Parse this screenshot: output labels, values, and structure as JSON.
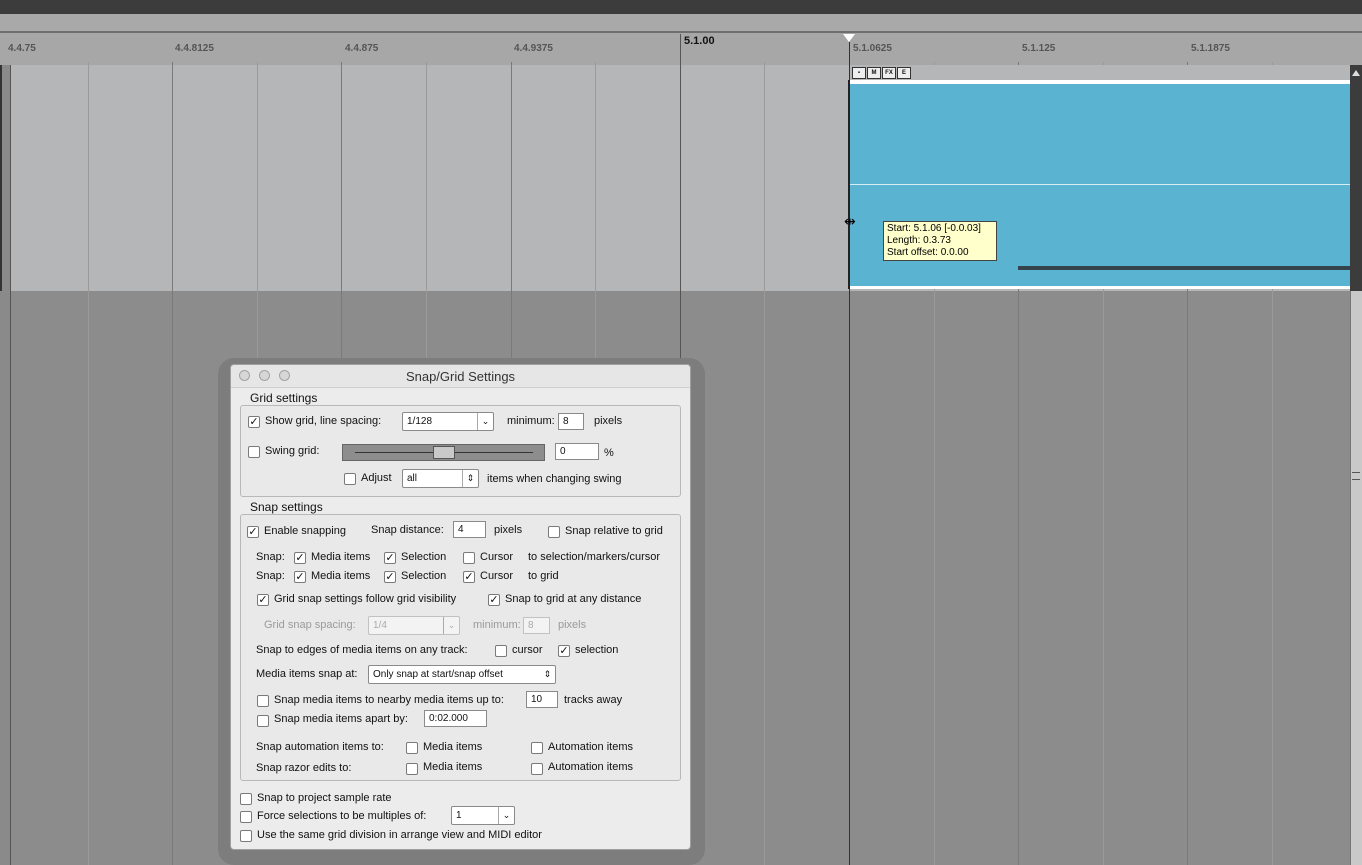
{
  "ruler": {
    "labels": [
      "4.4.75",
      "4.4.8125",
      "4.4.875",
      "4.4.9375",
      "5.1.00",
      "5.1.0625",
      "5.1.125",
      "5.1.1875"
    ]
  },
  "item_buttons": [
    "lock",
    "M",
    "FX",
    "E"
  ],
  "tooltip": {
    "start": "Start: 5.1.06 [-0.0.03]",
    "length": "Length: 0.3.73",
    "offset": "Start offset: 0.0.00"
  },
  "dialog": {
    "title": "Snap/Grid Settings",
    "grid": {
      "heading": "Grid settings",
      "show_grid_label": "Show grid, line spacing:",
      "show_grid_checked": true,
      "line_spacing": "1/128",
      "minimum_label": "minimum:",
      "minimum_value": "8",
      "pixels": "pixels",
      "swing_label": "Swing grid:",
      "swing_checked": false,
      "swing_value": "0",
      "percent": "%",
      "swing_level": 0.5,
      "adjust_label": "Adjust",
      "adjust_checked": false,
      "adjust_value": "all",
      "adjust_suffix": "items when changing swing"
    },
    "snap": {
      "heading": "Snap settings",
      "enable_label": "Enable snapping",
      "enable_checked": true,
      "distance_label": "Snap distance:",
      "distance_value": "4",
      "pixels": "pixels",
      "relative_label": "Snap relative to grid",
      "relative_checked": false,
      "row1": {
        "prefix": "Snap:",
        "media": "Media items",
        "media_checked": true,
        "selection": "Selection",
        "selection_checked": true,
        "cursor": "Cursor",
        "cursor_checked": false,
        "suffix": "to selection/markers/cursor"
      },
      "row2": {
        "prefix": "Snap:",
        "media": "Media items",
        "media_checked": true,
        "selection": "Selection",
        "selection_checked": true,
        "cursor": "Cursor",
        "cursor_checked": true,
        "suffix": "to grid"
      },
      "follow_label": "Grid snap settings follow grid visibility",
      "follow_checked": true,
      "any_distance_label": "Snap to grid at any distance",
      "any_distance_checked": true,
      "grid_spacing_label": "Grid snap spacing:",
      "grid_spacing_value": "1/4",
      "grid_min_label": "minimum:",
      "grid_min_value": "8",
      "grid_pixels": "pixels",
      "edges_label": "Snap to edges of media items on any track:",
      "edges_cursor": "cursor",
      "edges_cursor_checked": false,
      "edges_selection": "selection",
      "edges_selection_checked": true,
      "snap_at_label": "Media items snap at:",
      "snap_at_value": "Only snap at start/snap offset",
      "nearby_label": "Snap media items to nearby media items up to:",
      "nearby_checked": false,
      "nearby_value": "10",
      "nearby_suffix": "tracks away",
      "apart_label": "Snap media items apart by:",
      "apart_checked": false,
      "apart_value": "0:02.000",
      "automation_label": "Snap automation items to:",
      "automation_media": "Media items",
      "automation_media_checked": false,
      "automation_auto": "Automation items",
      "automation_auto_checked": false,
      "razor_label": "Snap razor edits to:",
      "razor_media": "Media items",
      "razor_media_checked": false,
      "razor_auto": "Automation items",
      "razor_auto_checked": false
    },
    "bottom": {
      "sample_rate_label": "Snap to project sample rate",
      "sample_rate_checked": false,
      "multiples_label": "Force selections to be multiples of:",
      "multiples_checked": false,
      "multiples_value": "1",
      "same_grid_label": "Use the same grid division in arrange view and MIDI editor",
      "same_grid_checked": false
    }
  }
}
